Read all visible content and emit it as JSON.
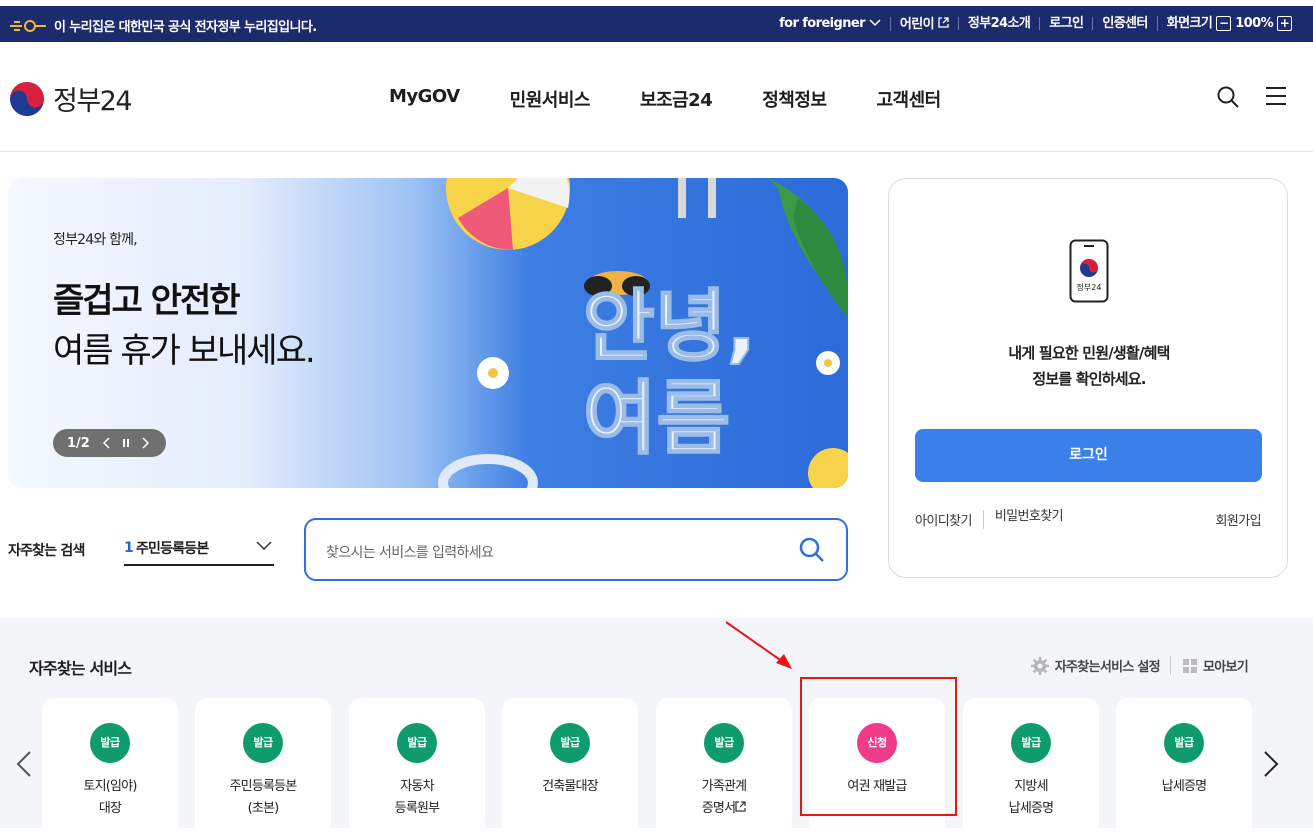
{
  "topbar": {
    "notice": "이 누리집은 대한민국 공식 전자정부 누리집입니다.",
    "util": [
      "for foreigner",
      "어린이",
      "정부24소개",
      "로그인",
      "인증센터",
      "화면크기"
    ],
    "zoom": "100%",
    "icons": [
      "emblem-icon",
      "chevron-down-icon",
      "external-link-icon",
      "minus-icon",
      "plus-icon"
    ]
  },
  "header": {
    "logo": "정부24",
    "nav": [
      "MyGOV",
      "민원서비스",
      "보조금24",
      "정책정보",
      "고객센터"
    ],
    "icons": [
      "search-icon",
      "menu-icon"
    ]
  },
  "banner": {
    "small": "정부24와 함께,",
    "headline_bold": "즐겁고 안전한",
    "headline": "여름 휴가 보내세요.",
    "art_text_1": "안녕,",
    "art_text_2": "여름",
    "pager": "1/2",
    "icons": [
      "prev-icon",
      "pause-icon",
      "next-icon"
    ]
  },
  "quick_search": {
    "label": "자주찾는 검색",
    "rank": "1",
    "selected": "주민등록등본",
    "placeholder": "찾으시는 서비스를 입력하세요"
  },
  "login_panel": {
    "phone_label": "정부24",
    "message_line1": "내게 필요한 민원/생활/혜택",
    "message_line2": "정보를 확인하세요.",
    "login_button": "로그인",
    "find_id": "아이디찾기",
    "find_pw": "비밀번호찾기",
    "join": "회원가입"
  },
  "services": {
    "title": "자주찾는 서비스",
    "settings": "자주찾는서비스 설정",
    "collect": "모아보기",
    "items": [
      {
        "badge": "발급",
        "line1": "토지(임야)",
        "line2": "대장",
        "color": "#0f9b6e"
      },
      {
        "badge": "발급",
        "line1": "주민등록등본",
        "line2": "(초본)",
        "color": "#0f9b6e"
      },
      {
        "badge": "발급",
        "line1": "자동차",
        "line2": "등록원부",
        "color": "#0f9b6e"
      },
      {
        "badge": "발급",
        "line1": "건축물대장",
        "line2": "",
        "color": "#0f9b6e"
      },
      {
        "badge": "발급",
        "line1": "가족관계",
        "line2": "증명서",
        "color": "#0f9b6e"
      },
      {
        "badge": "신청",
        "line1": "여권 재발급",
        "line2": "",
        "color": "#ef3b8a"
      },
      {
        "badge": "발급",
        "line1": "지방세",
        "line2": "납세증명",
        "color": "#0f9b6e"
      },
      {
        "badge": "발급",
        "line1": "납세증명",
        "line2": "",
        "color": "#0f9b6e"
      }
    ]
  },
  "colors": {
    "topbar": "#1c2b6b",
    "primary": "#3b80e8",
    "badge_green": "#0f9b6e",
    "badge_pink": "#ef3b8a",
    "highlight_red": "#e61717"
  }
}
